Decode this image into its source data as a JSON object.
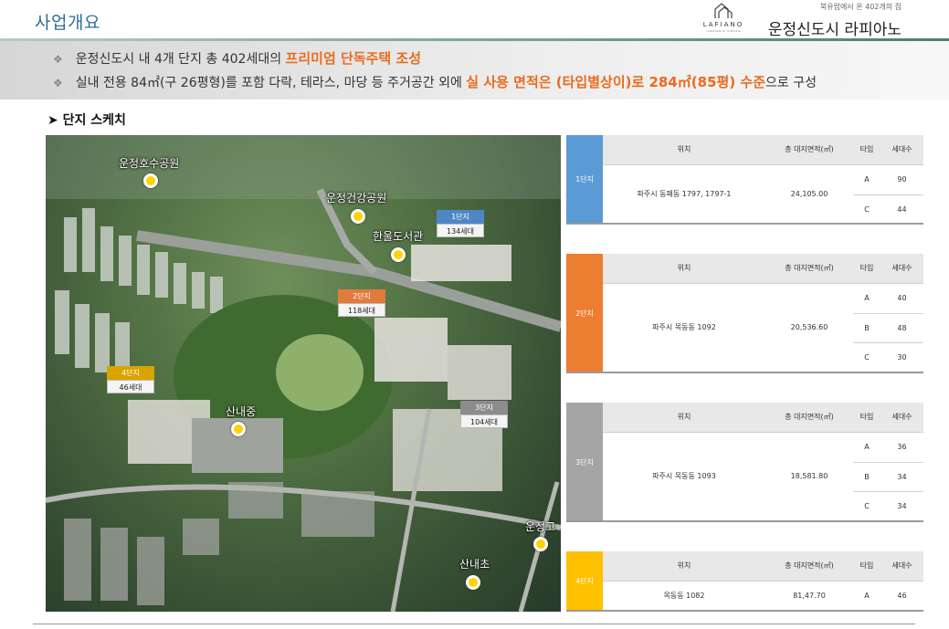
{
  "header": {
    "title": "사업개요",
    "brand_sub": "북유럽에서 온 402개의 집",
    "brand_name": "운정신도시 라피아노",
    "logo_text": "LAFIANO",
    "logo_tagline": "LANDMARK BY SAMSUNG"
  },
  "summary": {
    "line1_pre": "운정신도시 내 4개 단지 총 402세대의 ",
    "line1_hl": "프리미엄 단독주택 조성",
    "line2_pre": "실내 전용 84㎡(구 26평형)를 포함 다락, 테라스, 마당 등 주거공간 외에 ",
    "line2_hl": "실 사용 면적은 (타입별상이)로 284㎡(85평) 수준",
    "line2_post": "으로 구성"
  },
  "section_title": "단지 스케치",
  "map": {
    "pois": [
      "운정호수공원",
      "운정건강공원",
      "한울도서관",
      "산내중",
      "운정고",
      "산내초"
    ],
    "tags": [
      {
        "title": "1단지",
        "count": "134세대",
        "color": "#4f86c6"
      },
      {
        "title": "2단지",
        "count": "118세대",
        "color": "#e07b3c"
      },
      {
        "title": "3단지",
        "count": "104세대",
        "color": "#8c8c8c"
      },
      {
        "title": "4단지",
        "count": "46세대",
        "color": "#d9a300"
      }
    ]
  },
  "table_headers": {
    "location": "위치",
    "area": "총 대지면적(㎡)",
    "type": "타입",
    "units": "세대수"
  },
  "blocks": [
    {
      "name": "1단지",
      "color": "#5b9bd5",
      "location": "파주시 동패동 1797, 1797-1",
      "area": "24,105.00",
      "rows": [
        {
          "type": "A",
          "units": "90"
        },
        {
          "type": "C",
          "units": "44"
        }
      ]
    },
    {
      "name": "2단지",
      "color": "#ed7d31",
      "location": "파주시 목동동 1092",
      "area": "20,536.60",
      "rows": [
        {
          "type": "A",
          "units": "40"
        },
        {
          "type": "B",
          "units": "48"
        },
        {
          "type": "C",
          "units": "30"
        }
      ]
    },
    {
      "name": "3단지",
      "color": "#a5a5a5",
      "location": "파주시 목동동 1093",
      "area": "18,581.80",
      "rows": [
        {
          "type": "A",
          "units": "36"
        },
        {
          "type": "B",
          "units": "34"
        },
        {
          "type": "C",
          "units": "34"
        }
      ]
    },
    {
      "name": "4단지",
      "color": "#ffc000",
      "location": "목동동 1082",
      "area": "81,47.70",
      "rows": [
        {
          "type": "A",
          "units": "46"
        }
      ]
    }
  ],
  "icons": {
    "bullet": "diamond-bullet-icon",
    "section": "chevron-right-icon",
    "poi": "location-pin-icon"
  }
}
